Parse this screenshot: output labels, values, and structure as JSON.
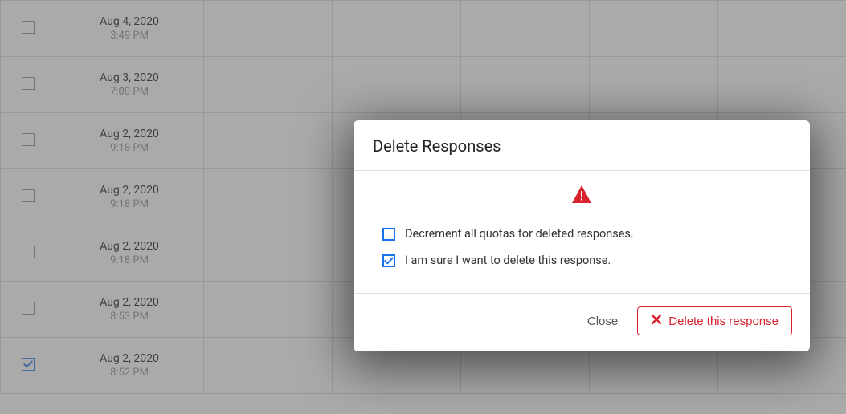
{
  "table": {
    "rows": [
      {
        "checked": false,
        "date": "Aug 4, 2020",
        "time": "3:49 PM"
      },
      {
        "checked": false,
        "date": "Aug 3, 2020",
        "time": "7:00 PM"
      },
      {
        "checked": false,
        "date": "Aug 2, 2020",
        "time": "9:18 PM"
      },
      {
        "checked": false,
        "date": "Aug 2, 2020",
        "time": "9:18 PM"
      },
      {
        "checked": false,
        "date": "Aug 2, 2020",
        "time": "9:18 PM"
      },
      {
        "checked": false,
        "date": "Aug 2, 2020",
        "time": "8:53 PM"
      },
      {
        "checked": true,
        "date": "Aug 2, 2020",
        "time": "8:52 PM"
      }
    ]
  },
  "modal": {
    "title": "Delete Responses",
    "options": {
      "decrement": {
        "checked": false,
        "label": "Decrement all quotas for deleted responses."
      },
      "confirm": {
        "checked": true,
        "label": "I am sure I want to delete this response."
      }
    },
    "close_label": "Close",
    "delete_label": "Delete this response"
  },
  "colors": {
    "danger": "#d9232e",
    "primary": "#1a73e8"
  }
}
